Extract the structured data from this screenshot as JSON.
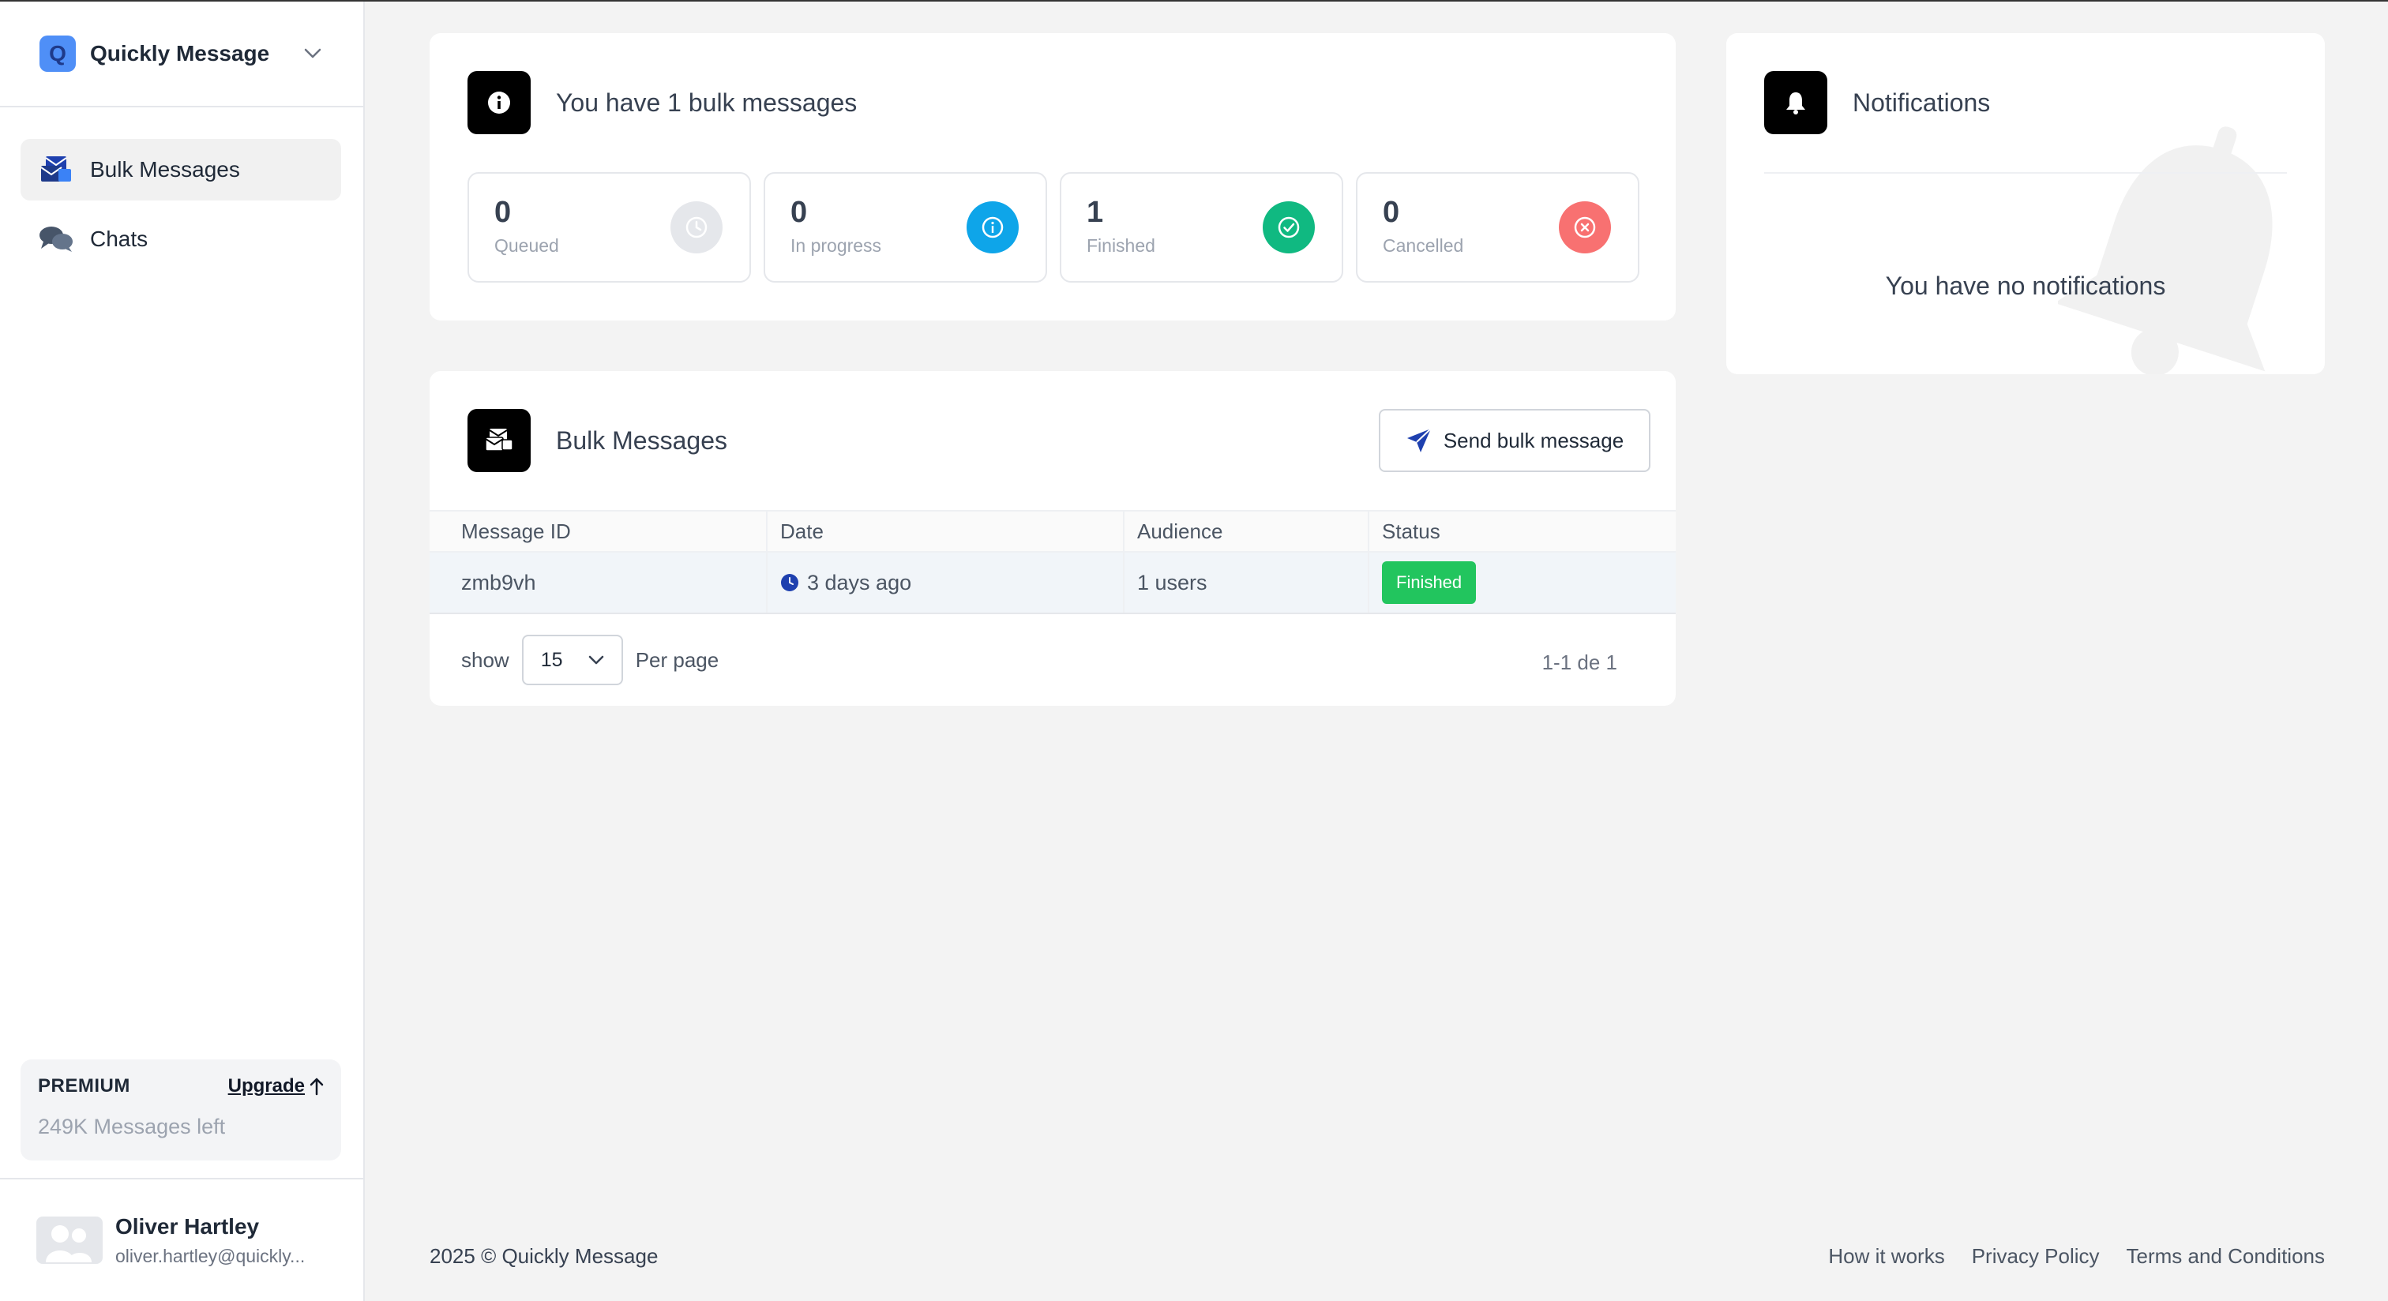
{
  "app": {
    "name": "Quickly Message",
    "logo_letter": "Q"
  },
  "sidebar": {
    "items": [
      {
        "label": "Bulk Messages",
        "icon": "bulk-messages-icon",
        "active": true
      },
      {
        "label": "Chats",
        "icon": "chats-icon",
        "active": false
      }
    ],
    "premium": {
      "title": "PREMIUM",
      "upgrade_label": "Upgrade",
      "messages_left": "249K Messages left"
    },
    "user": {
      "name": "Oliver Hartley",
      "email": "oliver.hartley@quickly..."
    }
  },
  "summary": {
    "title": "You have 1 bulk messages",
    "stats": [
      {
        "value": "0",
        "label": "Queued",
        "color": "#e5e7eb",
        "icon": "clock-icon"
      },
      {
        "value": "0",
        "label": "In progress",
        "color": "#0ea5e9",
        "icon": "info-icon"
      },
      {
        "value": "1",
        "label": "Finished",
        "color": "#10b981",
        "icon": "check-icon"
      },
      {
        "value": "0",
        "label": "Cancelled",
        "color": "#f87171",
        "icon": "x-icon"
      }
    ]
  },
  "bulk": {
    "title": "Bulk Messages",
    "send_label": "Send bulk message",
    "columns": [
      "Message ID",
      "Date",
      "Audience",
      "Status"
    ],
    "rows": [
      {
        "id": "zmb9vh",
        "date": "3 days ago",
        "audience": "1 users",
        "status": "Finished"
      }
    ],
    "pager": {
      "show": "show",
      "per_page_value": "15",
      "per_page": "Per page",
      "range": "1-1 de 1"
    }
  },
  "notifications": {
    "title": "Notifications",
    "empty": "You have no notifications"
  },
  "footer": {
    "copyright": "2025 © Quickly Message",
    "links": [
      "How it works",
      "Privacy Policy",
      "Terms and Conditions"
    ]
  },
  "colors": {
    "accent": "#4f8ff7",
    "success": "#22c55e",
    "info": "#0ea5e9",
    "danger": "#f87171"
  }
}
